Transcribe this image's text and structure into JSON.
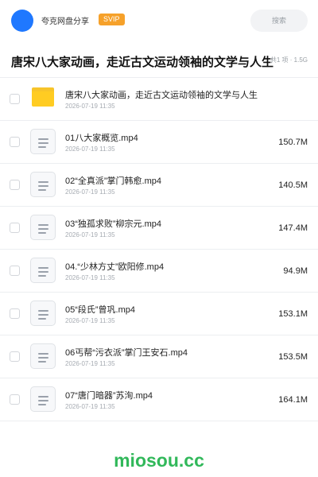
{
  "header": {
    "app_name": "夸克网盘分享",
    "badge": "SVIP",
    "search_placeholder": "搜索"
  },
  "folder": {
    "title": "唐宋八大家动画，走近古文运动领袖的文学与人生",
    "summary": "共1 项 · 1.5G"
  },
  "items": [
    {
      "type": "folder",
      "name": "唐宋八大家动画，走近古文运动领袖的文学与人生",
      "date": "2026-07-19 11:35",
      "size": ""
    },
    {
      "type": "file",
      "name": "01八大家概览.mp4",
      "date": "2026-07-19 11:35",
      "size": "150.7M"
    },
    {
      "type": "file",
      "name": "02“全真派”掌门韩愈.mp4",
      "date": "2026-07-19 11:35",
      "size": "140.5M"
    },
    {
      "type": "file",
      "name": "03“独孤求败”柳宗元.mp4",
      "date": "2026-07-19 11:35",
      "size": "147.4M"
    },
    {
      "type": "file",
      "name": "04.“少林方丈”欧阳修.mp4",
      "date": "2026-07-19 11:35",
      "size": "94.9M"
    },
    {
      "type": "file",
      "name": "05“段氏”曾巩.mp4",
      "date": "2026-07-19 11:35",
      "size": "153.1M"
    },
    {
      "type": "file",
      "name": "06丐帮“污衣派”掌门王安石.mp4",
      "date": "2026-07-19 11:35",
      "size": "153.5M"
    },
    {
      "type": "file",
      "name": "07“唐门暗器”苏洵.mp4",
      "date": "2026-07-19 11:35",
      "size": "164.1M"
    }
  ],
  "watermark": "miosou.cc"
}
